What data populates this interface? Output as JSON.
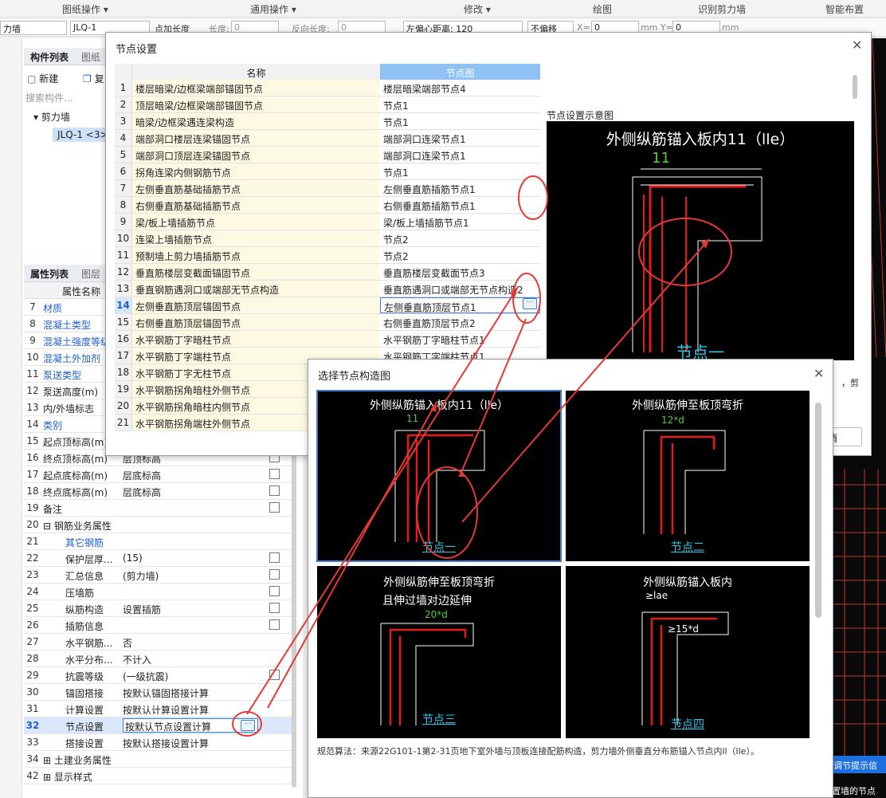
{
  "ribbon": [
    "图纸操作 ▾",
    "通用操作 ▾",
    "修改 ▾",
    "绘图",
    "识别剪力墙",
    "智能布置"
  ],
  "toolbar": {
    "type_select": "力墙",
    "name_select": "JLQ-1",
    "chk_add_len": "点加长度",
    "start_len": "长度:",
    "start_len_val": "0",
    "end_len": "反向长度:",
    "end_len_val": "0",
    "offset": "左偏心距离: 120",
    "no_offset": "不偏移",
    "x_lbl": "X=",
    "x_val": "0",
    "mm1": "mm Y=",
    "y_val": "0",
    "mm2": "mm"
  },
  "left": {
    "comp_tab": "构件列表",
    "draw_tab": "图纸",
    "new_btn": "新建",
    "copy_btn": "复",
    "search_placeholder": "搜索构件...",
    "tree_root": "剪力墙",
    "tree_child": "JLQ-1 <3>",
    "prop_tab": "属性列表",
    "layer_tab": "图层",
    "prop_header_name": "属性名称",
    "rows": [
      {
        "n": "7",
        "name": "材质",
        "val": "",
        "link": true,
        "chk": false
      },
      {
        "n": "8",
        "name": "混凝土类型",
        "val": "",
        "link": true,
        "chk": false
      },
      {
        "n": "9",
        "name": "混凝土强度等级",
        "val": "",
        "link": true,
        "chk": false
      },
      {
        "n": "10",
        "name": "混凝土外加剂",
        "val": "",
        "link": true,
        "chk": false
      },
      {
        "n": "11",
        "name": "泵送类型",
        "val": "",
        "link": true,
        "chk": false
      },
      {
        "n": "12",
        "name": "泵送高度(m)",
        "val": "",
        "link": false,
        "chk": false
      },
      {
        "n": "13",
        "name": "内/外墙标志",
        "val": "",
        "link": false,
        "chk": false
      },
      {
        "n": "14",
        "name": "类别",
        "val": "",
        "link": true,
        "chk": false
      },
      {
        "n": "15",
        "name": "起点顶标高(m)",
        "val": "",
        "link": false,
        "chk": false
      },
      {
        "n": "16",
        "name": "终点顶标高(m)",
        "val": "层顶标高",
        "link": false,
        "chk": true
      },
      {
        "n": "17",
        "name": "起点底标高(m)",
        "val": "层底标高",
        "link": false,
        "chk": true
      },
      {
        "n": "18",
        "name": "终点底标高(m)",
        "val": "层底标高",
        "link": false,
        "chk": true
      },
      {
        "n": "19",
        "name": "备注",
        "val": "",
        "link": false,
        "chk": true
      },
      {
        "n": "20",
        "name": "⊟ 钢筋业务属性",
        "val": "",
        "link": false,
        "chk": false
      },
      {
        "n": "21",
        "name": "其它钢筋",
        "val": "",
        "link": true,
        "chk": false,
        "indent": true
      },
      {
        "n": "22",
        "name": "保护层厚...",
        "val": "(15)",
        "link": false,
        "chk": true,
        "indent": true
      },
      {
        "n": "23",
        "name": "汇总信息",
        "val": "(剪力墙)",
        "link": false,
        "chk": true,
        "indent": true
      },
      {
        "n": "24",
        "name": "压墙筋",
        "val": "",
        "link": false,
        "chk": true,
        "indent": true
      },
      {
        "n": "25",
        "name": "纵筋构造",
        "val": "设置插筋",
        "link": false,
        "chk": true,
        "indent": true
      },
      {
        "n": "26",
        "name": "插筋信息",
        "val": "",
        "link": false,
        "chk": true,
        "indent": true
      },
      {
        "n": "27",
        "name": "水平钢筋...",
        "val": "否",
        "link": false,
        "chk": false,
        "indent": true
      },
      {
        "n": "28",
        "name": "水平分布...",
        "val": "不计入",
        "link": false,
        "chk": false,
        "indent": true
      },
      {
        "n": "29",
        "name": "抗震等级",
        "val": "(一级抗震)",
        "link": false,
        "chk": true,
        "indent": true
      },
      {
        "n": "30",
        "name": "锚固搭接",
        "val": "按默认锚固搭接计算",
        "link": false,
        "chk": false,
        "indent": true
      },
      {
        "n": "31",
        "name": "计算设置",
        "val": "按默认计算设置计算",
        "link": false,
        "chk": false,
        "indent": true
      },
      {
        "n": "32",
        "name": "节点设置",
        "val": "按默认节点设置计算",
        "link": false,
        "chk": false,
        "indent": true,
        "sel": true
      },
      {
        "n": "33",
        "name": "搭接设置",
        "val": "按默认搭接设置计算",
        "link": false,
        "chk": false,
        "indent": true
      },
      {
        "n": "34",
        "name": "⊞ 土建业务属性",
        "val": "",
        "link": false,
        "chk": false
      },
      {
        "n": "42",
        "name": "⊞ 显示样式",
        "val": "",
        "link": false,
        "chk": false
      }
    ]
  },
  "node_dialog": {
    "title": "节点设置",
    "col_name": "名称",
    "col_diagram": "节点图",
    "preview_title": "节点设置示意图",
    "preview_heading": "外侧纵筋锚入板内11（lle）",
    "preview_dim": "11",
    "preview_label": "节点一",
    "cancel": "消",
    "right_snippet": "，剪",
    "rows": [
      {
        "n": "1",
        "name": "楼层暗梁/边框梁端部锚固节点",
        "node": "楼层暗梁端部节点4"
      },
      {
        "n": "2",
        "name": "顶层暗梁/边框梁端部锚固节点",
        "node": "节点1"
      },
      {
        "n": "3",
        "name": "暗梁/边框梁遇连梁构造",
        "node": "节点1"
      },
      {
        "n": "4",
        "name": "端部洞口楼层连梁锚固节点",
        "node": "端部洞口连梁节点1"
      },
      {
        "n": "5",
        "name": "端部洞口顶层连梁锚固节点",
        "node": "端部洞口连梁节点1"
      },
      {
        "n": "6",
        "name": "拐角连梁内侧钢筋节点",
        "node": "节点1"
      },
      {
        "n": "7",
        "name": "左侧垂直筋基础插筋节点",
        "node": "左侧垂直筋插筋节点1"
      },
      {
        "n": "8",
        "name": "右侧垂直筋基础插筋节点",
        "node": "右侧垂直筋插筋节点1"
      },
      {
        "n": "9",
        "name": "梁/板上墙插筋节点",
        "node": "梁/板上墙插筋节点1"
      },
      {
        "n": "10",
        "name": "连梁上墙插筋节点",
        "node": "节点2"
      },
      {
        "n": "11",
        "name": "预制墙上剪力墙插筋节点",
        "node": "节点2"
      },
      {
        "n": "12",
        "name": "垂直筋楼层变截面锚固节点",
        "node": "垂直筋楼层变截面节点3"
      },
      {
        "n": "13",
        "name": "垂直钢筋遇洞口或端部无节点构造",
        "node": "垂直筋遇洞口或端部无节点构造2"
      },
      {
        "n": "14",
        "name": "左侧垂直筋顶层锚固节点",
        "node": "左侧垂直筋顶层节点1",
        "sel": true
      },
      {
        "n": "15",
        "name": "右侧垂直筋顶层锚固节点",
        "node": "右侧垂直筋顶层节点2"
      },
      {
        "n": "16",
        "name": "水平钢筋丁字暗柱节点",
        "node": "水平钢筋丁字暗柱节点1"
      },
      {
        "n": "17",
        "name": "水平钢筋丁字端柱节点",
        "node": "水平钢筋丁字端柱节点1"
      },
      {
        "n": "18",
        "name": "水平钢筋丁字无柱节点",
        "node": ""
      },
      {
        "n": "19",
        "name": "水平钢筋拐角暗柱外侧节点",
        "node": ""
      },
      {
        "n": "20",
        "name": "水平钢筋拐角暗柱内侧节点",
        "node": ""
      },
      {
        "n": "21",
        "name": "水平钢筋拐角端柱外侧节点",
        "node": ""
      }
    ]
  },
  "select_dialog": {
    "title": "选择节点构造图",
    "thumbs": [
      {
        "title": "外侧纵筋锚入板内11（lle）",
        "dim": "11",
        "label": "节点一"
      },
      {
        "title": "外侧纵筋伸至板顶弯折",
        "dim": "12*d",
        "label": "节点二"
      },
      {
        "title": "外侧纵筋伸至板顶弯折",
        "title2": "且伸过墙对边延伸",
        "dim": "20*d",
        "label": "节点三"
      },
      {
        "title": "外侧纵筋锚入板内",
        "dim": "≥lae",
        "dim2": "≥15*d",
        "label": "节点四"
      }
    ],
    "footer": "规范算法：来源22G101-1第2-31页地下室外墙与顶板连接配筋构造，剪力墙外侧垂直分布筋锚入节点内ll（lle）。"
  },
  "right_bg": {
    "t1": "调节提示信",
    "t2": "置墙的节点"
  },
  "colors": {
    "accent": "#3a7fd8",
    "annotation_red": "#e53935",
    "cad_red": "#e31b1b",
    "cad_cyan": "#2ec6e8",
    "cad_green": "#4cd137"
  }
}
